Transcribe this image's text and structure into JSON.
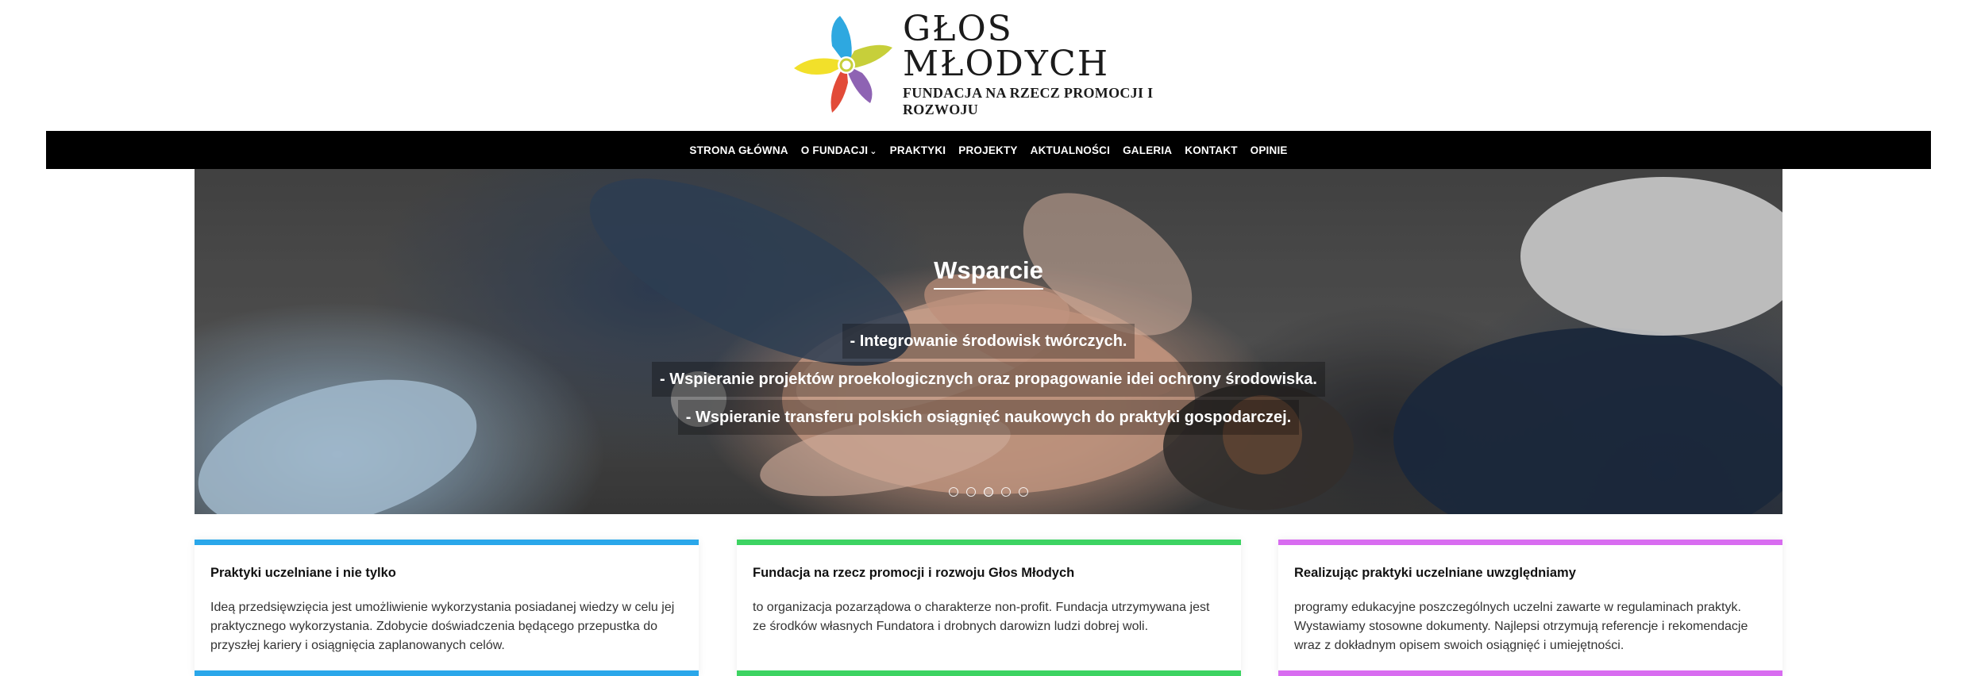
{
  "logo": {
    "title": "GŁOS MŁODYCH",
    "subtitle": "FUNDACJA NA RZECZ PROMOCJI I ROZWOJU",
    "colors": [
      "#2ea8e0",
      "#c7cf3a",
      "#8e63b3",
      "#e24b38",
      "#f2e02a"
    ]
  },
  "nav": {
    "items": [
      {
        "label": "STRONA GŁÓWNA"
      },
      {
        "label": "O FUNDACJI",
        "caret": "⌄"
      },
      {
        "label": "PRAKTYKI"
      },
      {
        "label": "PROJEKTY"
      },
      {
        "label": "AKTUALNOŚCI"
      },
      {
        "label": "GALERIA"
      },
      {
        "label": "KONTAKT"
      },
      {
        "label": "OPINIE"
      }
    ]
  },
  "hero": {
    "title": "Wsparcie",
    "lines": [
      "- Integrowanie środowisk twórczych.",
      "- Wspieranie projektów proekologicznych oraz propagowanie idei ochrony środowiska.",
      "- Wspieranie transferu polskich osiągnięć naukowych do praktyki gospodarczej."
    ],
    "slide_count": 5,
    "active_slide": 3
  },
  "cards": [
    {
      "title": "Praktyki uczelniane i nie tylko",
      "text": "Ideą przedsięwzięcia jest umożliwienie wykorzystania posiadanej wiedzy w celu jej praktycznego wykorzystania. Zdobycie doświadczenia będącego przepustka do przyszłej kariery i osiągnięcia zaplanowanych celów.",
      "color": "#2aa7ea"
    },
    {
      "title": "Fundacja na rzecz promocji i rozwoju Głos Młodych",
      "text": "to organizacja pozarządowa o charakterze non-profit. Fundacja utrzymywana jest ze środków własnych Fundatora i drobnych darowizn ludzi dobrej woli.",
      "color": "#3dd362"
    },
    {
      "title": "Realizując praktyki uczelniane uwzględniamy",
      "text": "programy edukacyjne poszczególnych uczelni zawarte w regulaminach praktyk. Wystawiamy stosowne dokumenty. Najlepsi otrzymują referencje i rekomendacje wraz z dokładnym opisem swoich osiągnięć i umiejętności.",
      "color": "#d86cf0"
    }
  ]
}
